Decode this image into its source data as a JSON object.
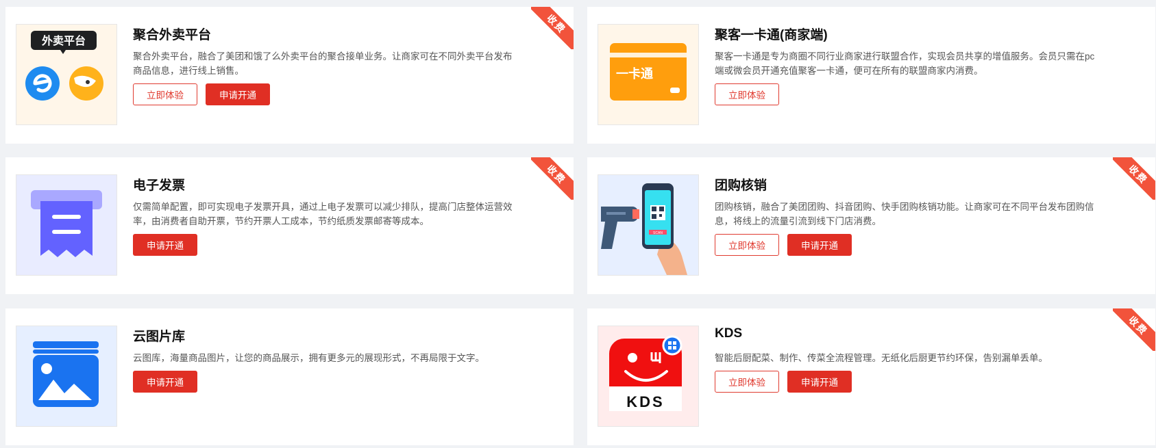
{
  "badge_label": "收费",
  "buttons": {
    "try": "立即体验",
    "apply": "申请开通"
  },
  "cards": [
    {
      "title": "聚合外卖平台",
      "desc": "聚合外卖平台，融合了美团和饿了么外卖平台的聚合接单业务。让商家可在不同外卖平台发布商品信息，进行线上销售。",
      "icon_text": "外卖平台"
    },
    {
      "title": "聚客一卡通(商家端)",
      "desc": "聚客一卡通是专为商圈不同行业商家进行联盟合作，实现会员共享的增值服务。会员只需在pc端或微会员开通充值聚客一卡通，便可在所有的联盟商家内消费。",
      "icon_text": "一卡通"
    },
    {
      "title": "电子发票",
      "desc": "仅需简单配置，即可实现电子发票开具，通过上电子发票可以减少排队，提高门店整体运营效率，由消费者自助开票，节约开票人工成本，节约纸质发票邮寄等成本。"
    },
    {
      "title": "团购核销",
      "desc": "团购核销，融合了美团团购、抖音团购、快手团购核销功能。让商家可在不同平台发布团购信息，将线上的流量引流到线下门店消费。",
      "icon_text": "SCAN"
    },
    {
      "title": "云图片库",
      "desc": "云图库，海量商品图片，让您的商品展示，拥有更多元的展现形式，不再局限于文字。"
    },
    {
      "title": "KDS",
      "desc": "智能后厨配菜、制作、传菜全流程管理。无纸化后厨更节约环保，告别漏单丢单。",
      "icon_text": "KDS"
    }
  ],
  "colors": {
    "accent": "#e02f24",
    "ribbon": "#f2533b",
    "page_bg": "#f0f2f5"
  }
}
